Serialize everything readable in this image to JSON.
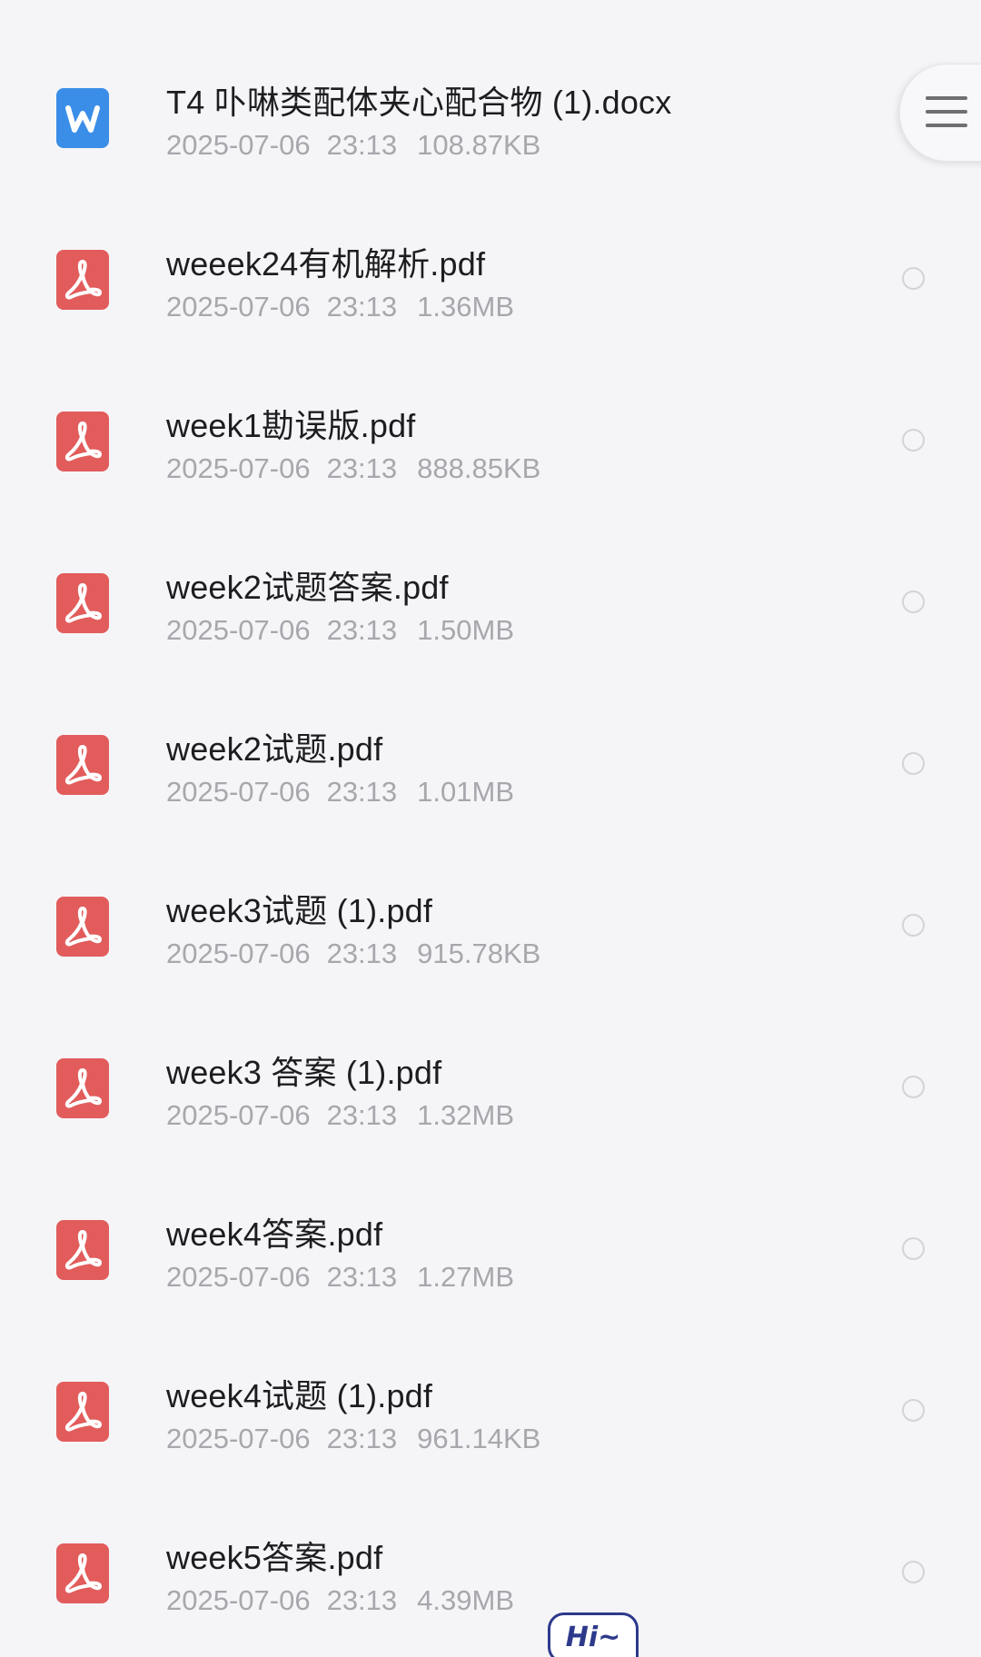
{
  "files": [
    {
      "type": "word",
      "icon": "word-document-icon",
      "name": "T4 卟啉类配体夹心配合物 (1).docx",
      "date": "2025-07-06",
      "time": "23:13",
      "size": "108.87KB"
    },
    {
      "type": "pdf",
      "icon": "pdf-document-icon",
      "name": "weeek24有机解析.pdf",
      "date": "2025-07-06",
      "time": "23:13",
      "size": "1.36MB"
    },
    {
      "type": "pdf",
      "icon": "pdf-document-icon",
      "name": "week1勘误版.pdf",
      "date": "2025-07-06",
      "time": "23:13",
      "size": "888.85KB"
    },
    {
      "type": "pdf",
      "icon": "pdf-document-icon",
      "name": "week2试题答案.pdf",
      "date": "2025-07-06",
      "time": "23:13",
      "size": "1.50MB"
    },
    {
      "type": "pdf",
      "icon": "pdf-document-icon",
      "name": "week2试题.pdf",
      "date": "2025-07-06",
      "time": "23:13",
      "size": "1.01MB"
    },
    {
      "type": "pdf",
      "icon": "pdf-document-icon",
      "name": "week3试题 (1).pdf",
      "date": "2025-07-06",
      "time": "23:13",
      "size": "915.78KB"
    },
    {
      "type": "pdf",
      "icon": "pdf-document-icon",
      "name": "week3 答案 (1).pdf",
      "date": "2025-07-06",
      "time": "23:13",
      "size": "1.32MB"
    },
    {
      "type": "pdf",
      "icon": "pdf-document-icon",
      "name": "week4答案.pdf",
      "date": "2025-07-06",
      "time": "23:13",
      "size": "1.27MB"
    },
    {
      "type": "pdf",
      "icon": "pdf-document-icon",
      "name": "week4试题 (1).pdf",
      "date": "2025-07-06",
      "time": "23:13",
      "size": "961.14KB"
    },
    {
      "type": "pdf",
      "icon": "pdf-document-icon",
      "name": "week5答案.pdf",
      "date": "2025-07-06",
      "time": "23:13",
      "size": "4.39MB"
    }
  ],
  "menu_button": {
    "icon": "hamburger-menu-icon"
  },
  "assistant_badge": {
    "label": "Hi~"
  },
  "colors": {
    "background": "#f5f5f7",
    "word_icon": "#3a8ee8",
    "pdf_icon": "#e25c5c",
    "name_text": "#1d1d1f",
    "meta_text": "#a7a7ad",
    "badge_accent": "#2d3a8c"
  }
}
